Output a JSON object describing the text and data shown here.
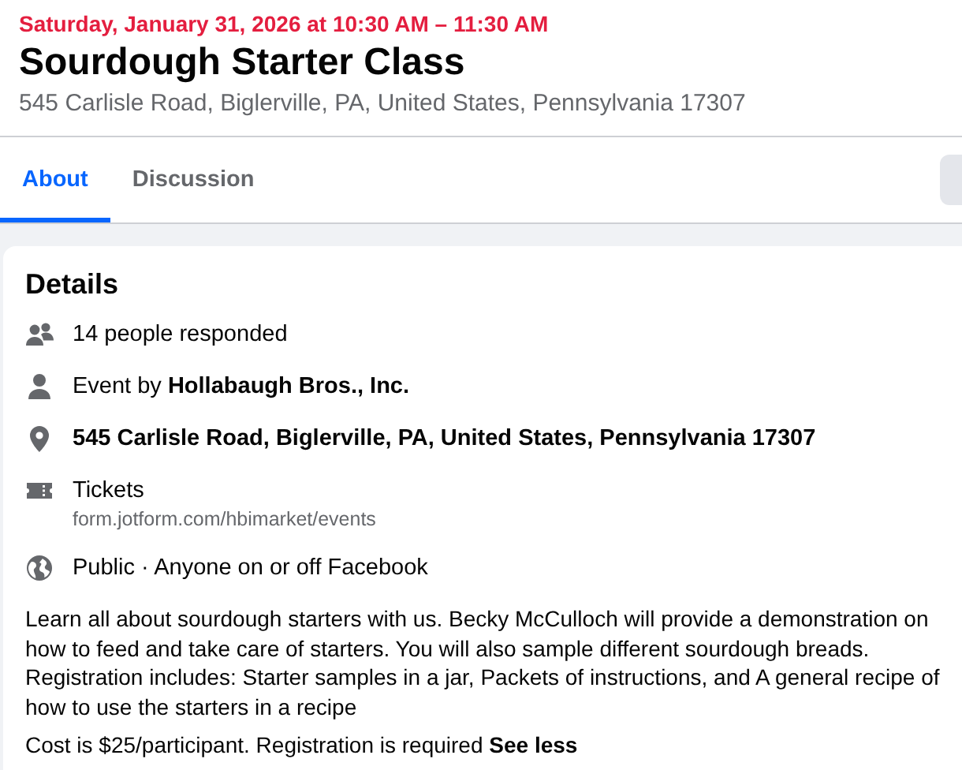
{
  "event": {
    "date_time": "Saturday, January 31, 2026 at 10:30 AM – 11:30 AM",
    "title": "Sourdough Starter Class",
    "address": "545 Carlisle Road, Biglerville, PA, United States, Pennsylvania 17307"
  },
  "tabs": [
    {
      "label": "About",
      "selected": true
    },
    {
      "label": "Discussion",
      "selected": false
    }
  ],
  "details": {
    "heading": "Details",
    "items": [
      {
        "kind": "people",
        "text": "14 people responded"
      },
      {
        "kind": "host",
        "text": "Event by **Hollabaugh Bros., Inc.**"
      },
      {
        "kind": "location",
        "text": "**545 Carlisle Road, Biglerville, PA, United States, Pennsylvania 17307**"
      },
      {
        "kind": "tickets",
        "text": "Tickets",
        "sublabel": "form.jotform.com/hbimarket/events"
      },
      {
        "kind": "privacy",
        "text": "Public · Anyone on or off Facebook"
      }
    ],
    "description": "Learn all about sourdough starters with us. Becky McCulloch will provide a demonstration on how to feed and take care of starters. You will also sample different sourdough breads. Registration includes: Starter samples in a jar, Packets of instructions, and A general recipe of how to use the starters in a recipe",
    "note": "Cost is $25/participant. Registration is required",
    "toggle_link": "See less"
  }
}
